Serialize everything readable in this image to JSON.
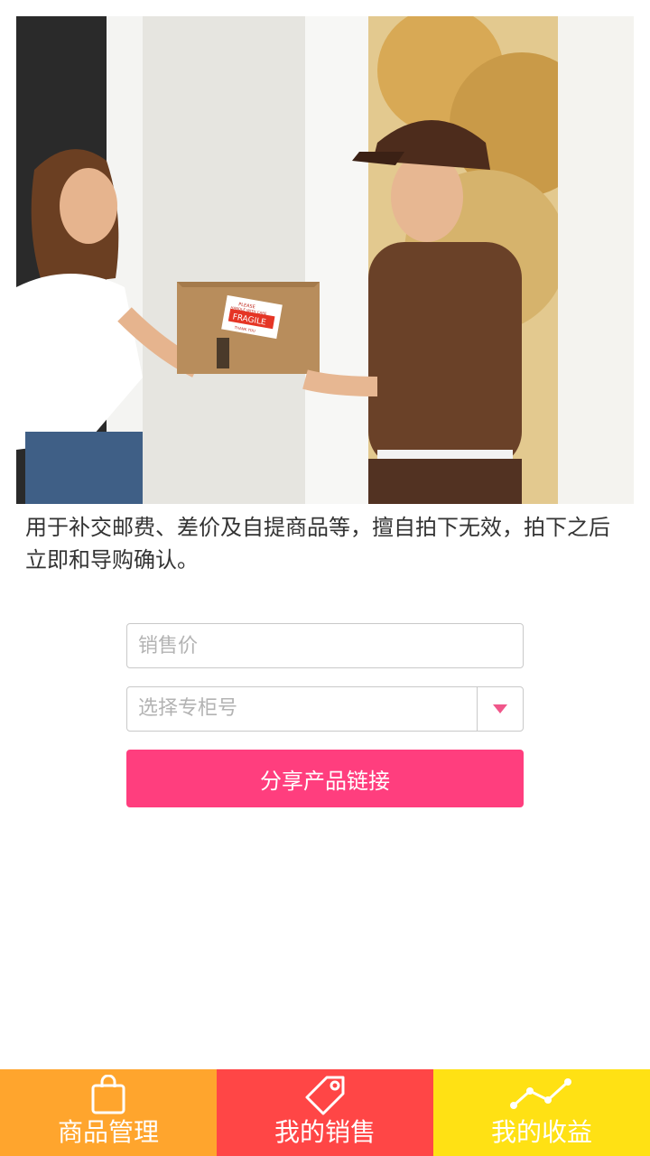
{
  "description": "用于补交邮费、差价及自提商品等，擅自拍下无效，拍下之后立即和导购确认。",
  "form": {
    "price_placeholder": "销售价",
    "counter_placeholder": "选择专柜号",
    "share_button": "分享产品链接"
  },
  "hero": {
    "label_line1": "PLEASE",
    "label_line2": "HANDLE WITH CARE",
    "label_main": "FRAGILE",
    "label_line3": "THANK YOU"
  },
  "tabs": [
    {
      "label": "商品管理",
      "icon": "shopping-bag-icon",
      "color": "#ffa52d"
    },
    {
      "label": "我的销售",
      "icon": "price-tag-icon",
      "color": "#ff4646"
    },
    {
      "label": "我的收益",
      "icon": "trend-line-icon",
      "color": "#ffe114"
    }
  ],
  "colors": {
    "accent": "#ff3e7e",
    "placeholder": "#b3b3b3",
    "dropdown_arrow": "#f0568a"
  }
}
